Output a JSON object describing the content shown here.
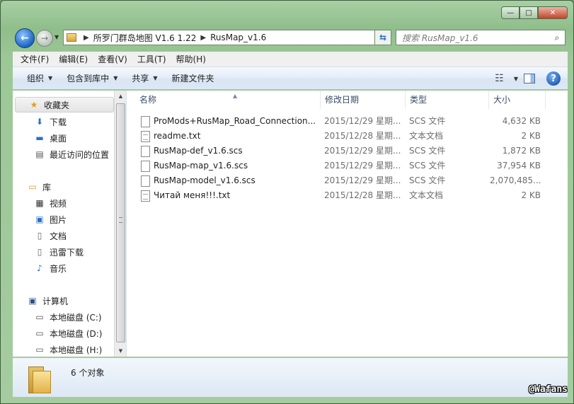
{
  "window": {
    "minimize": "—",
    "maximize": "□",
    "close": "✕"
  },
  "address": {
    "back": "←",
    "forward": "→",
    "crumbs": [
      "所罗门群岛地图 V1.6 1.22",
      "RusMap_v1.6"
    ],
    "search_placeholder": "搜索 RusMap_v1.6"
  },
  "menu": [
    "文件(F)",
    "编辑(E)",
    "查看(V)",
    "工具(T)",
    "帮助(H)"
  ],
  "toolbar": {
    "organize": "组织",
    "include_in_library": "包含到库中",
    "share": "共享",
    "new_folder": "新建文件夹"
  },
  "nav": {
    "favorites": "收藏夹",
    "downloads": "下载",
    "desktop": "桌面",
    "recent": "最近访问的位置",
    "libraries": "库",
    "videos": "视频",
    "pictures": "图片",
    "documents": "文档",
    "thunder": "迅雷下载",
    "music": "音乐",
    "computer": "计算机",
    "disk_c": "本地磁盘 (C:)",
    "disk_d": "本地磁盘 (D:)",
    "disk_h": "本地磁盘 (H:)"
  },
  "columns": {
    "name": "名称",
    "date": "修改日期",
    "type": "类型",
    "size": "大小"
  },
  "files": [
    {
      "name": "ProMods+RusMap_Road_Connection...",
      "date": "2015/12/29 星期...",
      "type": "SCS 文件",
      "size": "4,632 KB"
    },
    {
      "name": "readme.txt",
      "date": "2015/12/28 星期...",
      "type": "文本文档",
      "size": "2 KB"
    },
    {
      "name": "RusMap-def_v1.6.scs",
      "date": "2015/12/29 星期...",
      "type": "SCS 文件",
      "size": "1,872 KB"
    },
    {
      "name": "RusMap-map_v1.6.scs",
      "date": "2015/12/29 星期...",
      "type": "SCS 文件",
      "size": "37,954 KB"
    },
    {
      "name": "RusMap-model_v1.6.scs",
      "date": "2015/12/29 星期...",
      "type": "SCS 文件",
      "size": "2,070,485..."
    },
    {
      "name": "Читай меня!!!.txt",
      "date": "2015/12/28 星期...",
      "type": "文本文档",
      "size": "2 KB"
    }
  ],
  "details": {
    "count": "6 个对象"
  },
  "watermark": "@Wafans"
}
